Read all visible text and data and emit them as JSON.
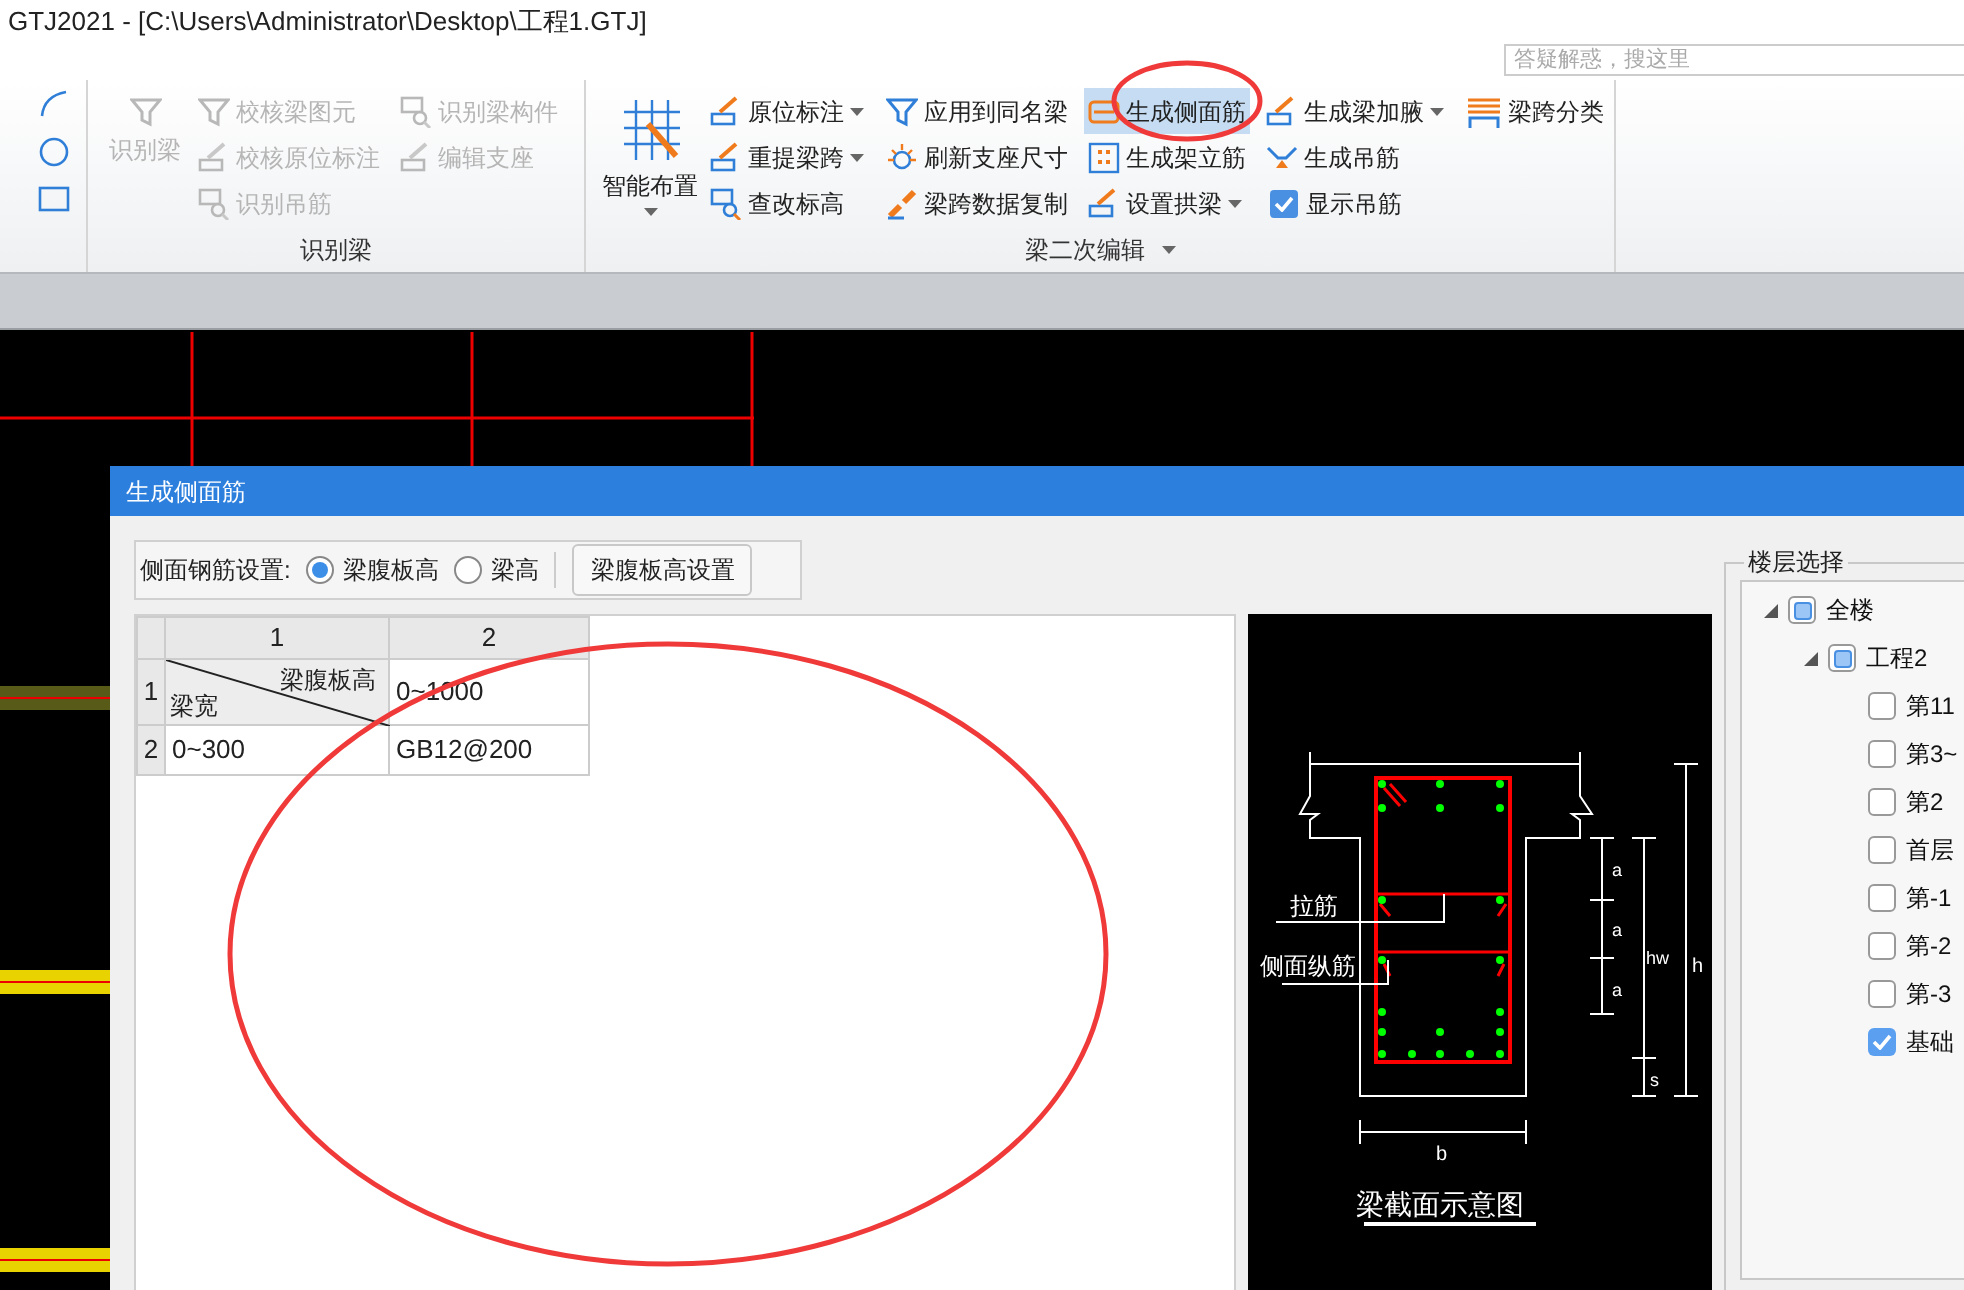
{
  "window": {
    "title": "GTJ2021 - [C:\\Users\\Administrator\\Desktop\\工程1.GTJ]"
  },
  "search": {
    "placeholder": "答疑解惑，搜这里"
  },
  "ribbon": {
    "groups": [
      {
        "label": "识别梁",
        "dropdown": false,
        "large": {
          "label": "识别梁",
          "disabled": true,
          "dropdown": false
        },
        "columns": [
          [
            {
              "label": "校核梁图元",
              "disabled": true,
              "dropdown": false
            },
            {
              "label": "校核原位标注",
              "disabled": true,
              "dropdown": false
            },
            {
              "label": "识别吊筋",
              "disabled": true,
              "dropdown": false
            }
          ],
          [
            {
              "label": "识别梁构件",
              "disabled": true,
              "dropdown": false
            },
            {
              "label": "编辑支座",
              "disabled": true,
              "dropdown": false
            }
          ]
        ]
      },
      {
        "label": "梁二次编辑",
        "dropdown": true,
        "large": {
          "label": "智能布置",
          "disabled": false,
          "dropdown": true
        },
        "columns": [
          [
            {
              "label": "原位标注",
              "disabled": false,
              "dropdown": true
            },
            {
              "label": "重提梁跨",
              "disabled": false,
              "dropdown": true
            },
            {
              "label": "查改标高",
              "disabled": false,
              "dropdown": false
            }
          ],
          [
            {
              "label": "应用到同名梁",
              "disabled": false,
              "dropdown": false
            },
            {
              "label": "刷新支座尺寸",
              "disabled": false,
              "dropdown": false
            },
            {
              "label": "梁跨数据复制",
              "disabled": false,
              "dropdown": false
            }
          ],
          [
            {
              "label": "生成侧面筋",
              "disabled": false,
              "dropdown": false,
              "selected": true
            },
            {
              "label": "生成架立筋",
              "disabled": false,
              "dropdown": false,
              "selected": false
            },
            {
              "label": "设置拱梁",
              "disabled": false,
              "dropdown": true,
              "selected": false
            }
          ],
          [
            {
              "label": "生成梁加腋",
              "disabled": false,
              "dropdown": true
            },
            {
              "label": "生成吊筋",
              "disabled": false,
              "dropdown": false
            },
            {
              "label": "显示吊筋",
              "kind": "checkbox",
              "checked": true
            }
          ],
          [
            {
              "label": "梁跨分类",
              "disabled": false,
              "dropdown": false
            }
          ]
        ]
      }
    ]
  },
  "dialog": {
    "title": "生成侧面筋",
    "settings": {
      "label": "侧面钢筋设置:",
      "radios": [
        {
          "label": "梁腹板高",
          "selected": true
        },
        {
          "label": "梁高",
          "selected": false
        }
      ],
      "button": "梁腹板高设置"
    },
    "table": {
      "columns": [
        "1",
        "2"
      ],
      "rows": [
        {
          "header": "1",
          "cells": [
            {
              "kind": "diagonal",
              "top": "梁腹板高",
              "bottom": "梁宽"
            },
            {
              "kind": "text",
              "text": "0~1000"
            }
          ]
        },
        {
          "header": "2",
          "cells": [
            {
              "kind": "text",
              "text": "0~300"
            },
            {
              "kind": "text",
              "text": "GB12@200"
            }
          ]
        }
      ]
    },
    "diagram": {
      "tie_label": "拉筋",
      "side_label": "侧面纵筋",
      "dims": [
        "a",
        "a",
        "a"
      ],
      "hw": "hw",
      "h": "h",
      "s": "s",
      "b": "b",
      "caption": "梁截面示意图"
    },
    "floors": {
      "title": "楼层选择",
      "tree": [
        {
          "label": "全楼",
          "expanded": true,
          "partial": true,
          "children": [
            {
              "label": "工程2",
              "expanded": true,
              "partial": true,
              "children": [
                {
                  "label": "第11",
                  "checked": false
                },
                {
                  "label": "第3~",
                  "checked": false
                },
                {
                  "label": "第2",
                  "checked": false
                },
                {
                  "label": "首层",
                  "checked": false
                },
                {
                  "label": "第-1",
                  "checked": false
                },
                {
                  "label": "第-2",
                  "checked": false
                },
                {
                  "label": "第-3",
                  "checked": false
                },
                {
                  "label": "基础",
                  "checked": true
                }
              ]
            }
          ]
        }
      ]
    }
  }
}
